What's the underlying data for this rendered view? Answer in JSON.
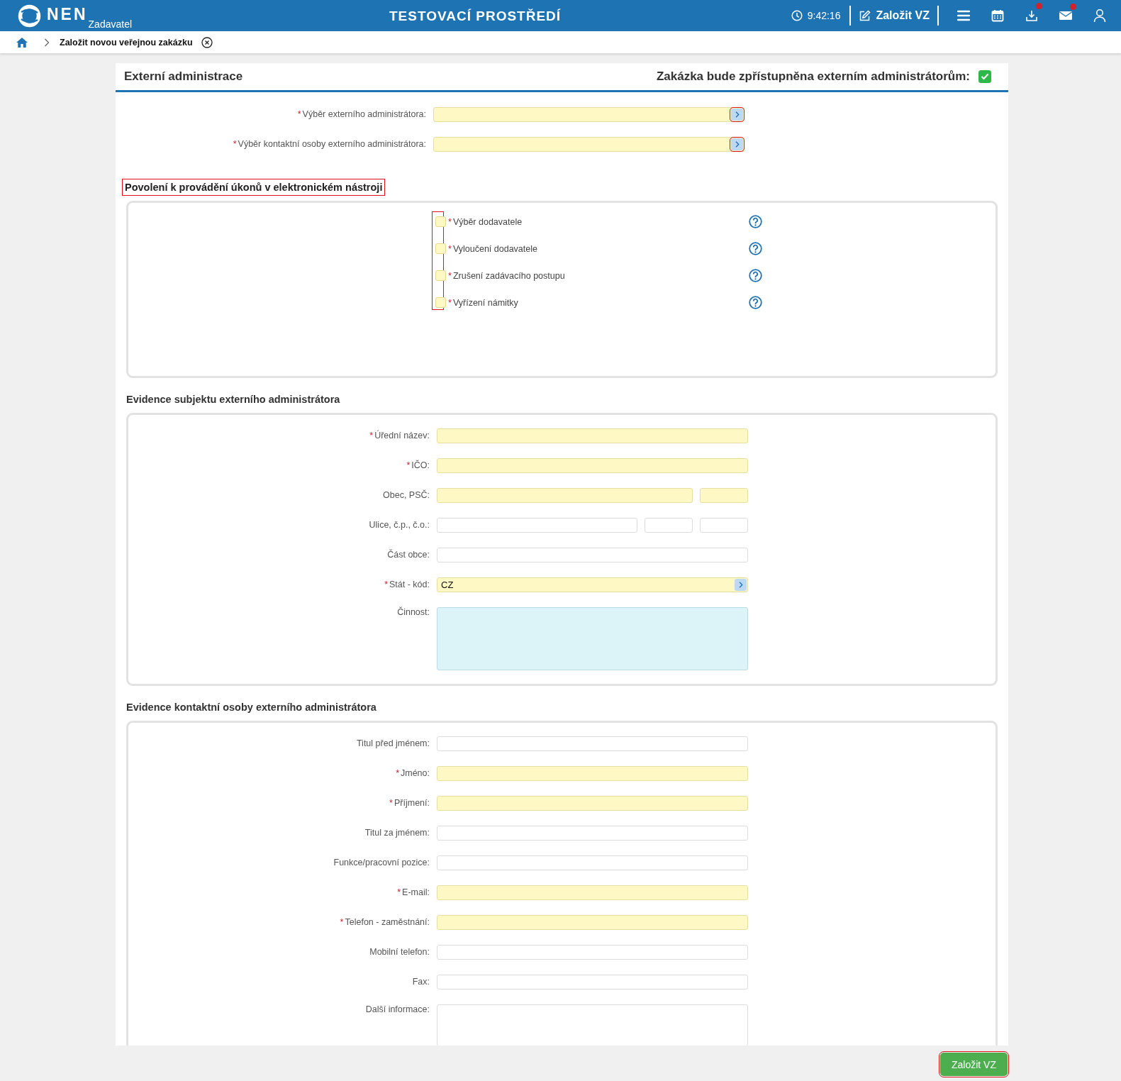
{
  "header": {
    "logo": "NEN",
    "role": "Zadavatel",
    "environment": "TESTOVACÍ PROSTŘEDÍ",
    "time": "9:42:16",
    "create_link": "Založit VZ",
    "icons": [
      {
        "kind": "menu",
        "badge": false
      },
      {
        "kind": "calendar",
        "badge": false
      },
      {
        "kind": "download",
        "badge": true
      },
      {
        "kind": "mail",
        "badge": true
      },
      {
        "kind": "user",
        "badge": false
      }
    ]
  },
  "breadcrumb": {
    "current": "Založit novou veřejnou zakázku"
  },
  "panel": {
    "title": "Externí administrace",
    "access_label": "Zakázka bude zpřístupněna externím administrátorům:",
    "access_checked": true,
    "lookups": [
      {
        "mark": "*",
        "label": "Výběr externího administrátora:",
        "fields": [
          {
            "kind": "lookup",
            "required": true,
            "flagged": true
          }
        ]
      },
      {
        "mark": "*",
        "label": "Výběr kontaktní osoby externího administrátora:",
        "fields": [
          {
            "kind": "lookup",
            "required": true,
            "flagged": true
          }
        ]
      }
    ]
  },
  "permissions": {
    "title": "Povolení k provádění úkonů v elektronickém nástroji",
    "flagged": true,
    "checks_flagged": true,
    "items": [
      {
        "mark": "*",
        "label": "Výběr dodavatele",
        "checked": false
      },
      {
        "mark": "*",
        "label": "Vyloučení dodavatele",
        "checked": false
      },
      {
        "mark": "*",
        "label": "Zrušení zadávacího postupu",
        "checked": false
      },
      {
        "mark": "*",
        "label": "Vyřízení námitky",
        "checked": false
      }
    ]
  },
  "sections": [
    {
      "title": "Evidence subjektu externího administrátora",
      "rows": [
        {
          "mark": "*",
          "label": "Úřední název:",
          "fields": [
            {
              "kind": "text",
              "required": true
            }
          ]
        },
        {
          "mark": "*",
          "label": "IČO:",
          "fields": [
            {
              "kind": "text",
              "required": true
            }
          ]
        },
        {
          "label": "Obec, PSČ:",
          "fields": [
            {
              "kind": "text",
              "required": true
            },
            {
              "kind": "short",
              "required": true
            }
          ]
        },
        {
          "label": "Ulice, č.p., č.o.:",
          "fields": [
            {
              "kind": "text",
              "required": false
            },
            {
              "kind": "short",
              "required": false
            },
            {
              "kind": "short",
              "required": false
            }
          ]
        },
        {
          "label": "Část obce:",
          "fields": [
            {
              "kind": "text",
              "required": false
            }
          ]
        },
        {
          "mark": "*",
          "label": "Stát - kód:",
          "fields": [
            {
              "kind": "lookup",
              "required": true,
              "value": "CZ",
              "flagged": false
            }
          ]
        },
        {
          "label": "Činnost:",
          "fields": [
            {
              "kind": "textarea",
              "active": true
            }
          ]
        }
      ]
    },
    {
      "title": "Evidence kontaktní osoby externího administrátora",
      "rows": [
        {
          "label": "Titul před jménem:",
          "fields": [
            {
              "kind": "text",
              "required": false
            }
          ]
        },
        {
          "mark": "*",
          "label": "Jméno:",
          "fields": [
            {
              "kind": "text",
              "required": true
            }
          ]
        },
        {
          "mark": "*",
          "label": "Příjmení:",
          "fields": [
            {
              "kind": "text",
              "required": true
            }
          ]
        },
        {
          "label": "Titul za jménem:",
          "fields": [
            {
              "kind": "text",
              "required": false
            }
          ]
        },
        {
          "label": "Funkce/pracovní pozice:",
          "fields": [
            {
              "kind": "text",
              "required": false
            }
          ]
        },
        {
          "mark": "*",
          "label": "E-mail:",
          "fields": [
            {
              "kind": "text",
              "required": true
            }
          ]
        },
        {
          "mark": "*",
          "label": "Telefon - zaměstnání:",
          "fields": [
            {
              "kind": "text",
              "required": true
            }
          ]
        },
        {
          "label": "Mobilní telefon:",
          "fields": [
            {
              "kind": "text",
              "required": false
            }
          ]
        },
        {
          "label": "Fax:",
          "fields": [
            {
              "kind": "text",
              "required": false
            }
          ]
        },
        {
          "label": "Další informace:",
          "fields": [
            {
              "kind": "textarea",
              "active": false
            }
          ]
        }
      ]
    }
  ],
  "submit": {
    "label": "Založit VZ",
    "flagged": true
  }
}
